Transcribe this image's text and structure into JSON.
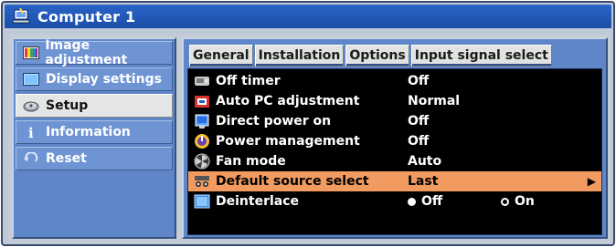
{
  "window": {
    "title": "Computer 1"
  },
  "menu": {
    "items": [
      {
        "label": "Image adjustment",
        "icon": "palette-icon",
        "selected": false
      },
      {
        "label": "Display settings",
        "icon": "monitor-icon",
        "selected": false
      },
      {
        "label": "Setup",
        "icon": "gear-icon",
        "selected": true
      },
      {
        "label": "Information",
        "icon": "info-icon",
        "selected": false
      },
      {
        "label": "Reset",
        "icon": "reset-arrow-icon",
        "selected": false
      }
    ]
  },
  "tabs": [
    {
      "label": "General",
      "active": true
    },
    {
      "label": "Installation",
      "active": false
    },
    {
      "label": "Options",
      "active": false
    },
    {
      "label": "Input signal select",
      "active": false
    }
  ],
  "settings": [
    {
      "label": "Off timer",
      "value": "Off",
      "icon": "timer-icon"
    },
    {
      "label": "Auto PC adjustment",
      "value": "Normal",
      "icon": "auto-adjust-icon"
    },
    {
      "label": "Direct power on",
      "value": "Off",
      "icon": "power-plug-icon"
    },
    {
      "label": "Power management",
      "value": "Off",
      "icon": "power-management-icon"
    },
    {
      "label": "Fan mode",
      "value": "Auto",
      "icon": "fan-icon"
    },
    {
      "label": "Default source select",
      "value": "Last",
      "icon": "source-select-icon",
      "selected": true
    },
    {
      "label": "Deinterlace",
      "icon": "deinterlace-icon",
      "options": [
        "Off",
        "On"
      ],
      "selected_option": "Off"
    }
  ],
  "colors": {
    "title_bar": "#1b4ea8",
    "panel_blue": "#5f86c8",
    "highlight": "#f29b60",
    "content_bg": "#000000"
  }
}
